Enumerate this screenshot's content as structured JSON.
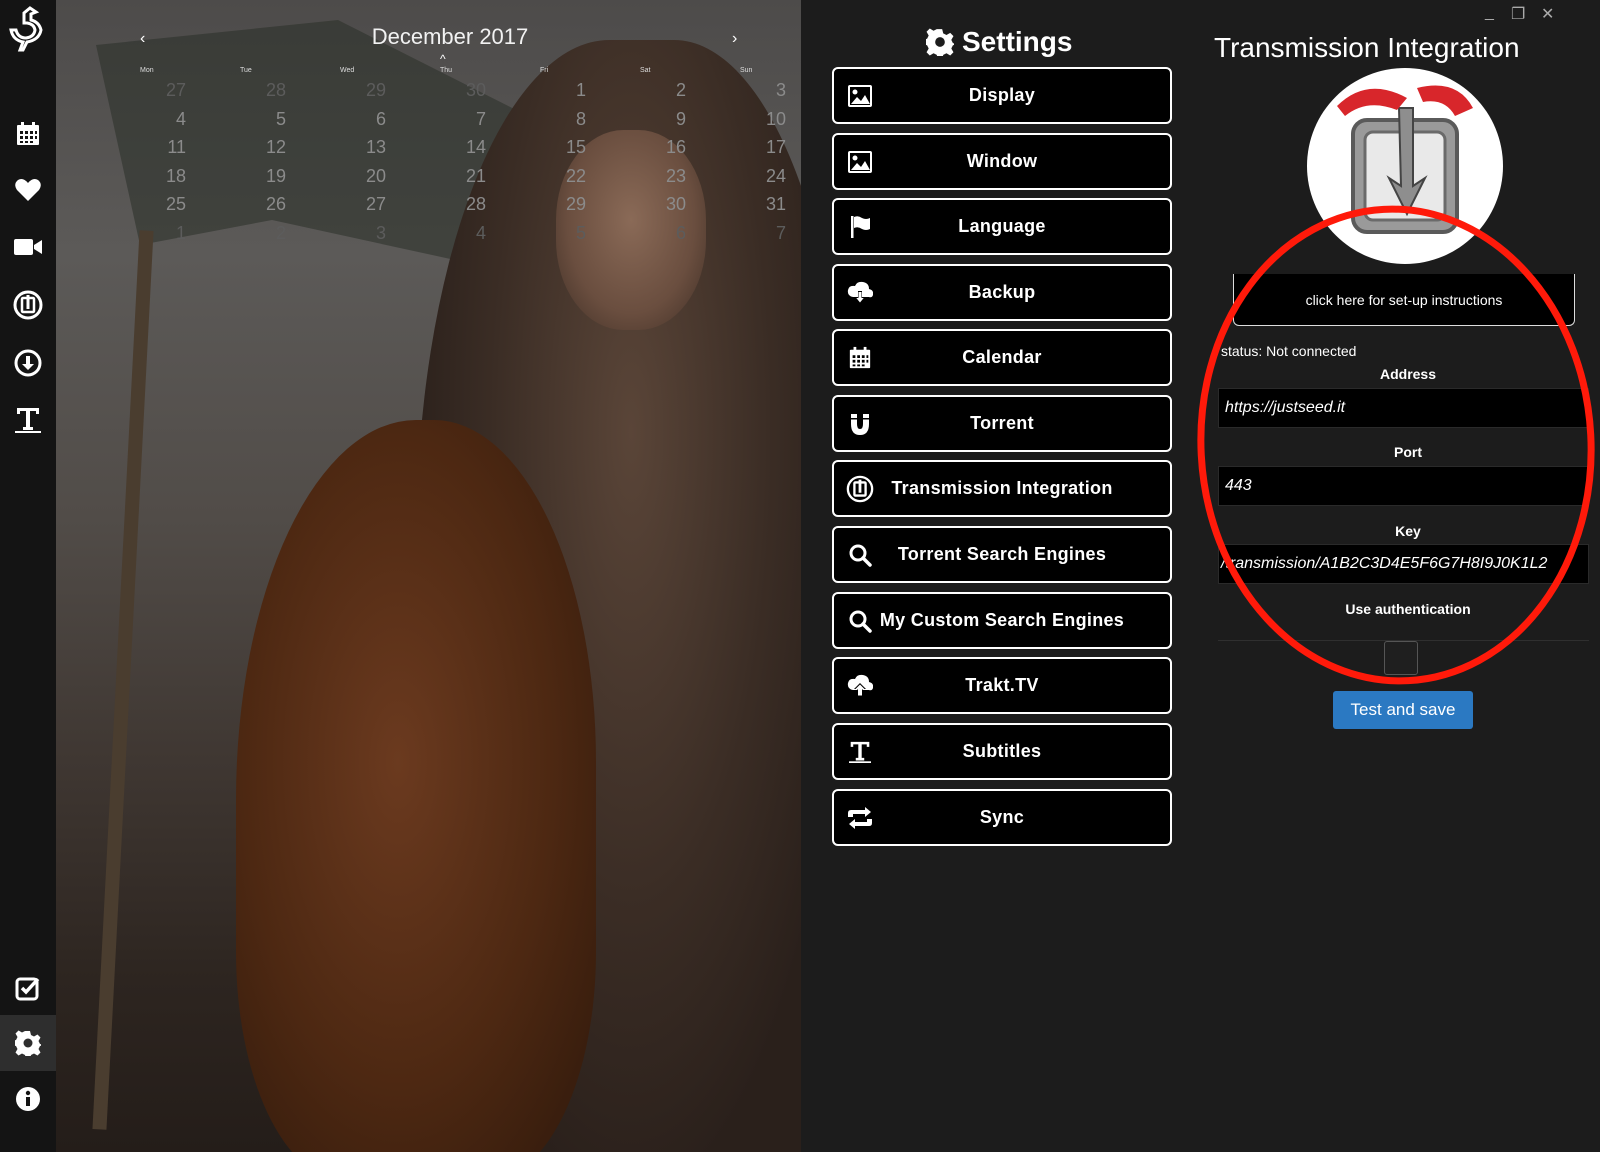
{
  "sidebar": {
    "items": [
      {
        "icon": "logo-bird-icon",
        "active": false
      },
      {
        "icon": "calendar-icon",
        "active": false
      },
      {
        "icon": "heart-icon",
        "active": false
      },
      {
        "icon": "video-camera-icon",
        "active": false
      },
      {
        "icon": "transmission-icon",
        "active": false
      },
      {
        "icon": "download-icon",
        "active": false
      },
      {
        "icon": "subtitles-icon",
        "active": false
      },
      {
        "icon": "checkbox-icon",
        "active": false
      },
      {
        "icon": "gear-icon",
        "active": true
      },
      {
        "icon": "info-icon",
        "active": false
      }
    ]
  },
  "calendar": {
    "title": "December 2017",
    "prev": "‹",
    "next": "›",
    "up": "^",
    "days": [
      "Mon",
      "Tue",
      "Wed",
      "Thu",
      "Fri",
      "Sat",
      "Sun"
    ],
    "weeks": [
      [
        "27",
        "28",
        "29",
        "30",
        "1",
        "2",
        "3"
      ],
      [
        "4",
        "5",
        "6",
        "7",
        "8",
        "9",
        "10"
      ],
      [
        "11",
        "12",
        "13",
        "14",
        "15",
        "16",
        "17"
      ],
      [
        "18",
        "19",
        "20",
        "21",
        "22",
        "23",
        "24"
      ],
      [
        "25",
        "26",
        "27",
        "28",
        "29",
        "30",
        "31"
      ],
      [
        "1",
        "2",
        "3",
        "4",
        "5",
        "6",
        "7"
      ]
    ]
  },
  "settings": {
    "title": "Settings",
    "menu": [
      {
        "label": "Display",
        "icon": "image-icon"
      },
      {
        "label": "Window",
        "icon": "image-icon"
      },
      {
        "label": "Language",
        "icon": "flag-icon"
      },
      {
        "label": "Backup",
        "icon": "cloud-download-icon"
      },
      {
        "label": "Calendar",
        "icon": "calendar-icon"
      },
      {
        "label": "Torrent",
        "icon": "magnet-icon"
      },
      {
        "label": "Transmission Integration",
        "icon": "transmission-icon"
      },
      {
        "label": "Torrent Search Engines",
        "icon": "search-icon"
      },
      {
        "label": "My Custom Search Engines",
        "icon": "search-icon"
      },
      {
        "label": "Trakt.TV",
        "icon": "cloud-upload-icon"
      },
      {
        "label": "Subtitles",
        "icon": "subtitles-icon"
      },
      {
        "label": "Sync",
        "icon": "sync-icon"
      }
    ]
  },
  "window_controls": {
    "minimize": "_",
    "restore": "❐",
    "close": "✕"
  },
  "detail": {
    "title": "Transmission Integration",
    "setup_button": "click here for set-up instructions",
    "status": "status: Not connected",
    "address_label": "Address",
    "address_value": "https://justseed.it",
    "port_label": "Port",
    "port_value": "443",
    "key_label": "Key",
    "key_value": "/transmission/A1B2C3D4E5F6G7H8I9J0K1L2",
    "auth_label": "Use authentication",
    "auth_checked": false,
    "submit_label": "Test and save"
  },
  "colors": {
    "accent_button": "#2b79c2",
    "annotation": "#ff1a0a",
    "panel_bg": "#1c1c1c"
  }
}
